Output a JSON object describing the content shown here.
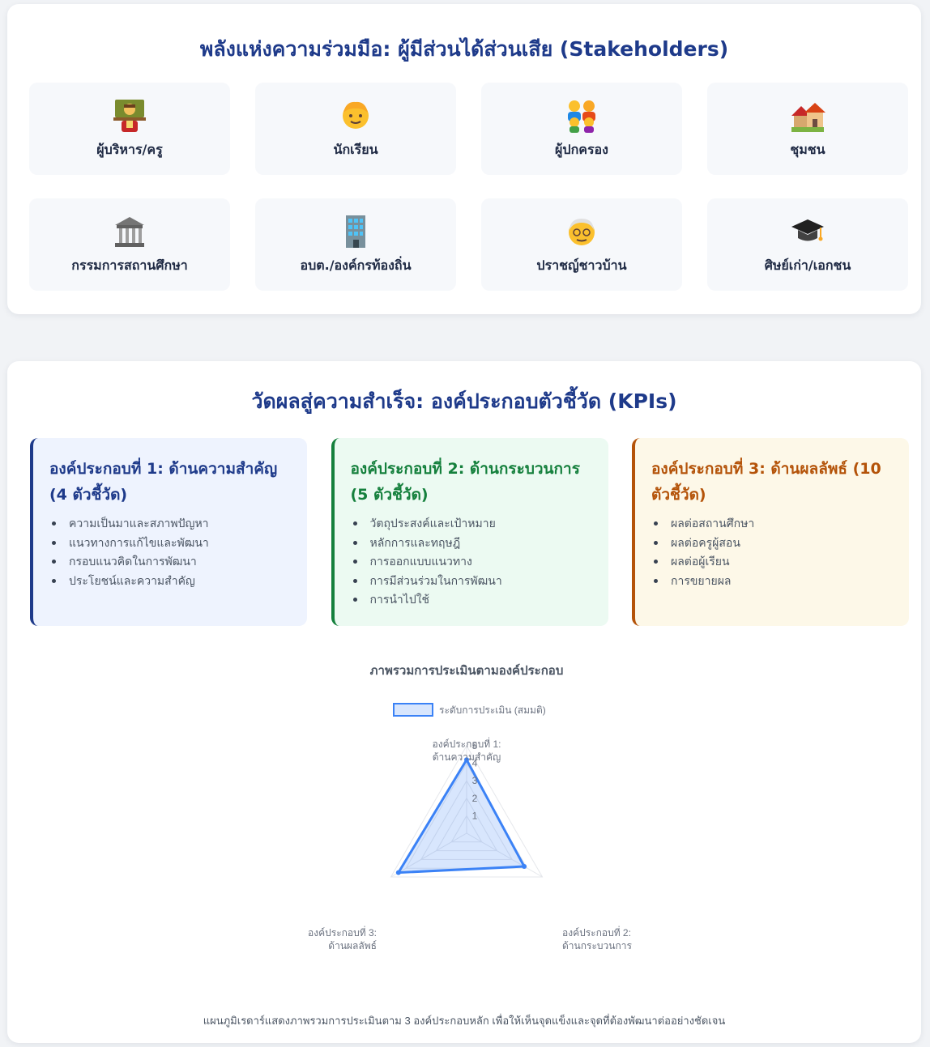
{
  "stakeholders": {
    "title": "พลังแห่งความร่วมมือ: ผู้มีส่วนได้ส่วนเสีย (Stakeholders)",
    "items": [
      {
        "label": "ผู้บริหาร/ครู",
        "icon": "teacher-icon"
      },
      {
        "label": "นักเรียน",
        "icon": "student-icon"
      },
      {
        "label": "ผู้ปกครอง",
        "icon": "family-icon"
      },
      {
        "label": "ชุมชน",
        "icon": "houses-icon"
      },
      {
        "label": "กรรมการสถานศึกษา",
        "icon": "classical-building-icon"
      },
      {
        "label": "อบต./องค์กรท้องถิ่น",
        "icon": "office-building-icon"
      },
      {
        "label": "ปราชญ์ชาวบ้าน",
        "icon": "elder-icon"
      },
      {
        "label": "ศิษย์เก่า/เอกชน",
        "icon": "graduation-cap-icon"
      }
    ]
  },
  "kpis": {
    "title": "วัดผลสู่ความสำเร็จ: องค์ประกอบตัวชี้วัด (KPIs)",
    "components": [
      {
        "title": "องค์ประกอบที่ 1: ด้านความสำคัญ (4 ตัวชี้วัด)",
        "items": [
          "ความเป็นมาและสภาพปัญหา",
          "แนวทางการแก้ไขและพัฒนา",
          "กรอบแนวคิดในการพัฒนา",
          "ประโยชน์และความสำคัญ"
        ],
        "color": "#1e3a8a"
      },
      {
        "title": "องค์ประกอบที่ 2: ด้านกระบวนการ (5 ตัวชี้วัด)",
        "items": [
          "วัตถุประสงค์และเป้าหมาย",
          "หลักการและทฤษฎี",
          "การออกแบบแนวทาง",
          "การมีส่วนร่วมในการพัฒนา",
          "การนำไปใช้"
        ],
        "color": "#15803d"
      },
      {
        "title": "องค์ประกอบที่ 3: ด้านผลลัพธ์ (10 ตัวชี้วัด)",
        "items": [
          "ผลต่อสถานศึกษา",
          "ผลต่อครูผู้สอน",
          "ผลต่อผู้เรียน",
          "การขยายผล"
        ],
        "color": "#b45309"
      }
    ]
  },
  "chart_data": {
    "type": "radar",
    "title": "ภาพรวมการประเมินตามองค์ประกอบ",
    "legend": "ระดับการประเมิน (สมมติ)",
    "legend_position": "top",
    "axes": [
      [
        "องค์ประกอบที่ 1:",
        "ด้านความสำคัญ"
      ],
      [
        "องค์ประกอบที่ 2:",
        "ด้านกระบวนการ"
      ],
      [
        "องค์ประกอบที่ 3:",
        "ด้านผลลัพธ์"
      ]
    ],
    "series": [
      {
        "name": "ระดับการประเมิน (สมมติ)",
        "values": [
          4.2,
          3.8,
          4.5
        ],
        "color": "#3b82f6"
      }
    ],
    "r_ticks": [
      "1",
      "2",
      "3",
      "4",
      "5"
    ],
    "r_range": [
      0,
      5
    ]
  },
  "footnote": "แผนภูมิเรดาร์แสดงภาพรวมการประเมินตาม 3 องค์ประกอบหลัก เพื่อให้เห็นจุดแข็งและจุดที่ต้องพัฒนาต่ออย่างชัดเจน"
}
